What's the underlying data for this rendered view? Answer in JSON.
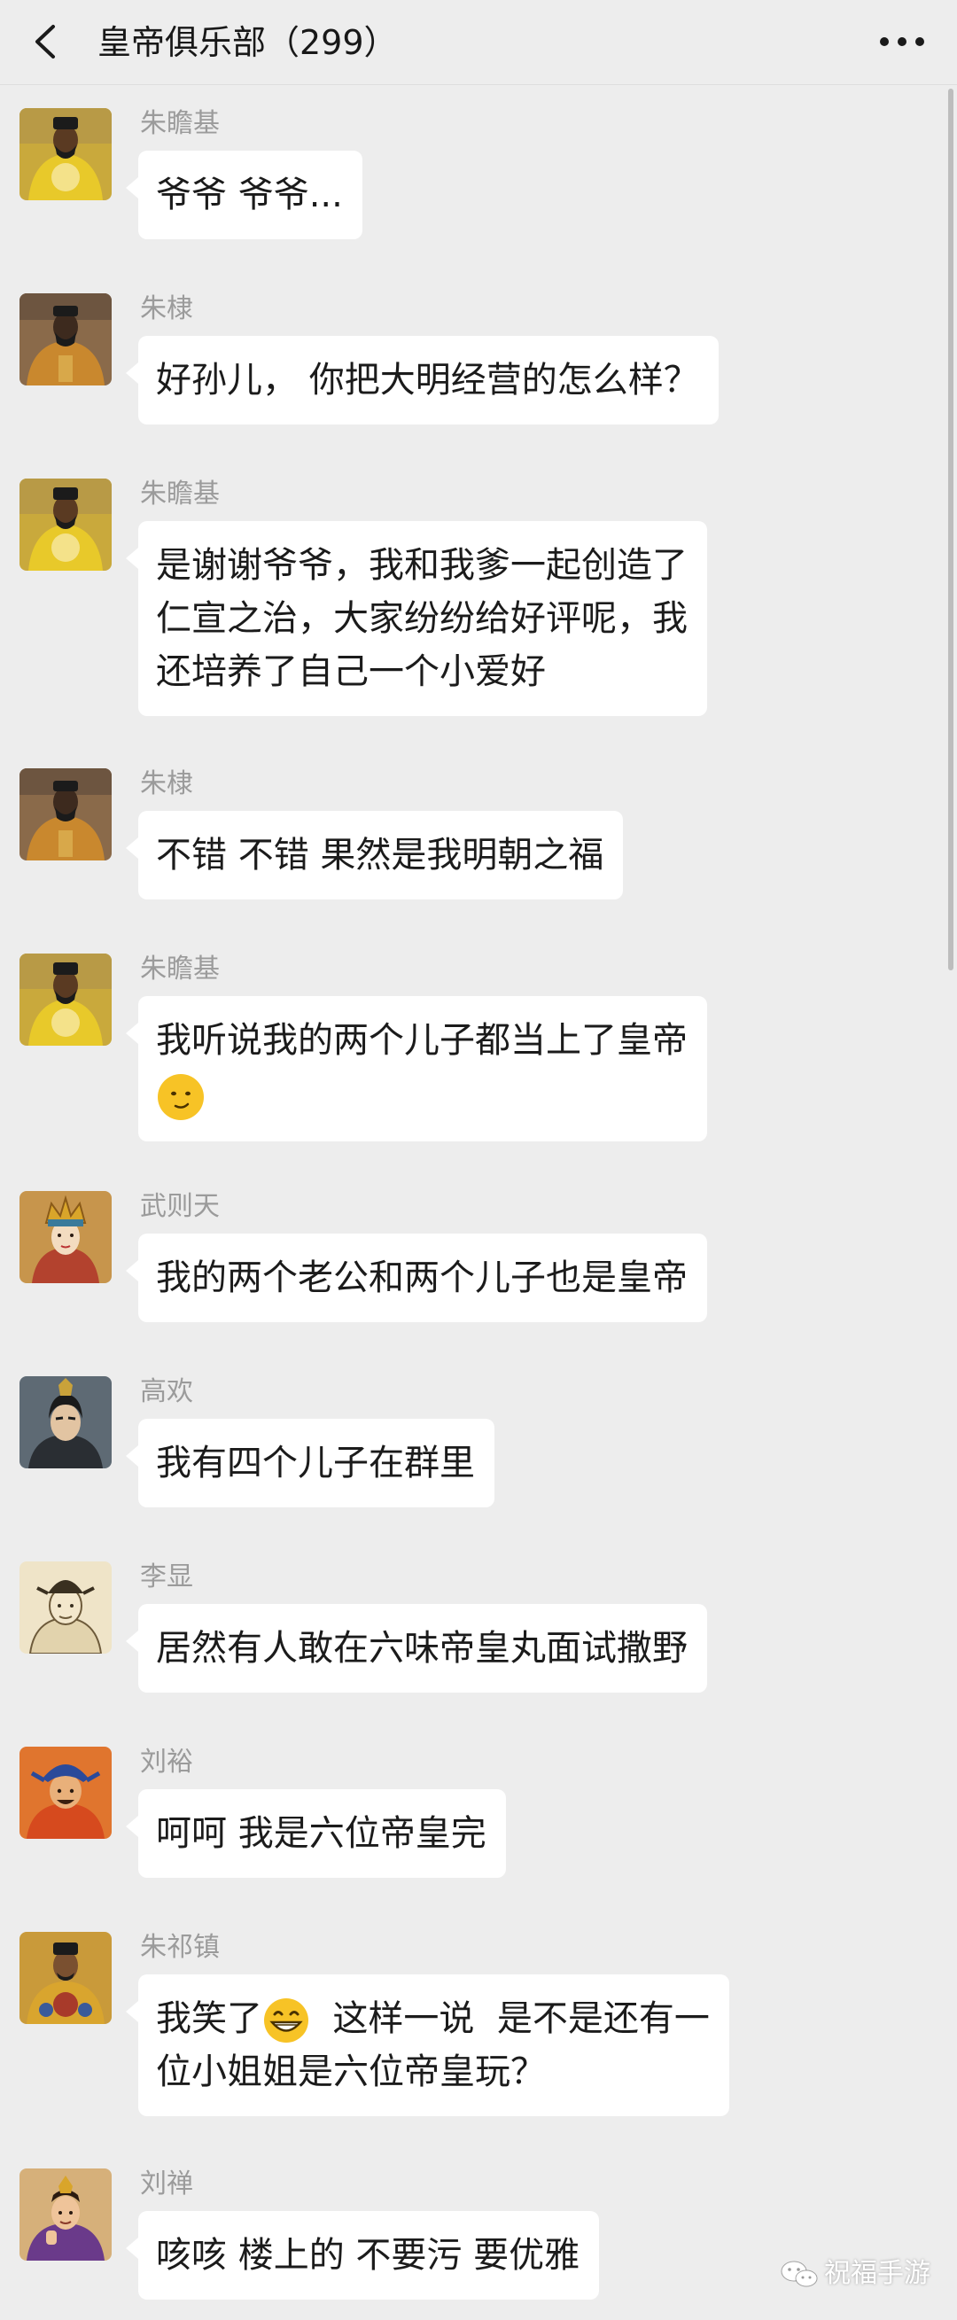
{
  "header": {
    "title": "皇帝俱乐部（299）"
  },
  "messages": [
    {
      "sender": "朱瞻基",
      "lines": [
        "爷爷 爷爷..."
      ],
      "avatar": "emperor-yellow-robe-avatar"
    },
    {
      "sender": "朱棣",
      "lines": [
        "好孙儿， 你把大明经营的怎么样？"
      ],
      "avatar": "emperor-seated-avatar"
    },
    {
      "sender": "朱瞻基",
      "lines": [
        "是谢谢爷爷，我和我爹一起创造了",
        "仁宣之治，大家纷纷给好评呢，我",
        "还培养了自己一个小爱好"
      ],
      "avatar": "emperor-yellow-robe-avatar"
    },
    {
      "sender": "朱棣",
      "lines": [
        "不错 不错 果然是我明朝之福"
      ],
      "avatar": "emperor-seated-avatar"
    },
    {
      "sender": "朱瞻基",
      "lines": [
        "我听说我的两个儿子都当上了皇帝"
      ],
      "emoji": "smug-face-emoji",
      "avatar": "emperor-yellow-robe-avatar"
    },
    {
      "sender": "武则天",
      "lines": [
        "我的两个老公和两个儿子也是皇帝"
      ],
      "avatar": "empress-crown-avatar"
    },
    {
      "sender": "高欢",
      "lines": [
        "我有四个儿子在群里"
      ],
      "avatar": "warrior-portrait-avatar"
    },
    {
      "sender": "李显",
      "lines": [
        "居然有人敢在六味帝皇丸面试撒野"
      ],
      "avatar": "emperor-sketch-avatar"
    },
    {
      "sender": "刘裕",
      "lines": [
        "呵呵  我是六位帝皇完"
      ],
      "avatar": "emperor-blue-hat-avatar"
    },
    {
      "sender": "朱祁镇",
      "lines": [
        "我笑了",
        "  这样一说  是不是还有一",
        "位小姐姐是六位帝皇玩？"
      ],
      "emoji": "grinning-face-emoji",
      "avatar": "emperor-dragon-robe-avatar"
    },
    {
      "sender": "刘禅",
      "lines": [
        "咳咳 楼上的 不要污 要优雅"
      ],
      "avatar": "emperor-purple-robe-avatar"
    }
  ],
  "watermark": {
    "text": "祝福手游"
  },
  "colors": {
    "background": "#ededed",
    "bubble": "#ffffff",
    "sender_name": "#9b9b9b",
    "text": "#1b1b1b"
  }
}
